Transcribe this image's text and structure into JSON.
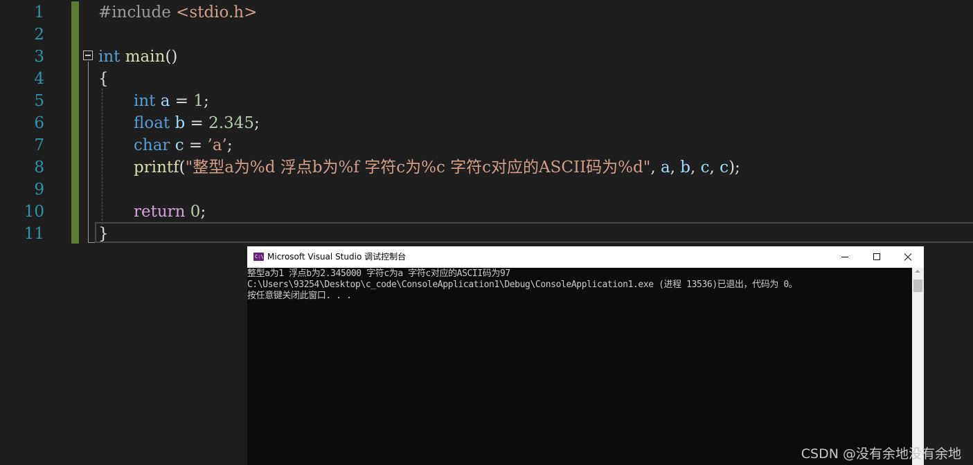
{
  "editor": {
    "line_numbers": [
      "1",
      "2",
      "3",
      "4",
      "5",
      "6",
      "7",
      "8",
      "9",
      "10",
      "11"
    ],
    "line1": {
      "directive": "#include",
      "header": "<stdio.h>"
    },
    "line3": {
      "type": "int",
      "name": "main",
      "parens": "()"
    },
    "line4": {
      "brace": "{"
    },
    "line5": {
      "type": "int",
      "var": "a",
      "op": " = ",
      "value": "1",
      "end": ";"
    },
    "line6": {
      "type": "float",
      "var": "b",
      "op": " = ",
      "value": "2.345",
      "end": ";"
    },
    "line7": {
      "type": "char",
      "var": "c",
      "op": " = ",
      "value": "’a’",
      "end": ";"
    },
    "line8": {
      "func": "printf",
      "open": "(",
      "format": "\"整型a为%d 浮点b为%f 字符c为%c 字符c对应的ASCII码为%d\"",
      "sep1": ", ",
      "a": "a",
      "sep2": ", ",
      "b": "b",
      "sep3": ", ",
      "c1": "c",
      "sep4": ", ",
      "c2": "c",
      "close": ");"
    },
    "line10": {
      "keyword": "return",
      "value": "0",
      "end": ";"
    },
    "line11": {
      "brace": "}"
    }
  },
  "console": {
    "icon_text": "C:\\",
    "title": "Microsoft Visual Studio 调试控制台",
    "lines": [
      "整型a为1 浮点b为2.345000 字符c为a 字符c对应的ASCII码为97",
      "C:\\Users\\93254\\Desktop\\c_code\\ConsoleApplication1\\Debug\\ConsoleApplication1.exe (进程 13536)已退出，代码为 0。",
      "按任意键关闭此窗口. . ."
    ]
  },
  "watermark": "CSDN @没有余地没有余地",
  "colors": {
    "editor_bg": "#1e1e1e",
    "line_number": "#2b91af",
    "keyword": "#569cd6",
    "function": "#dcdcaa",
    "variable": "#9cdcfe",
    "number": "#b5cea8",
    "string": "#d69d85",
    "control_keyword": "#d8a0df",
    "change_bar": "#577d30",
    "console_bg": "#0c0c0c",
    "console_text": "#cccccc"
  }
}
